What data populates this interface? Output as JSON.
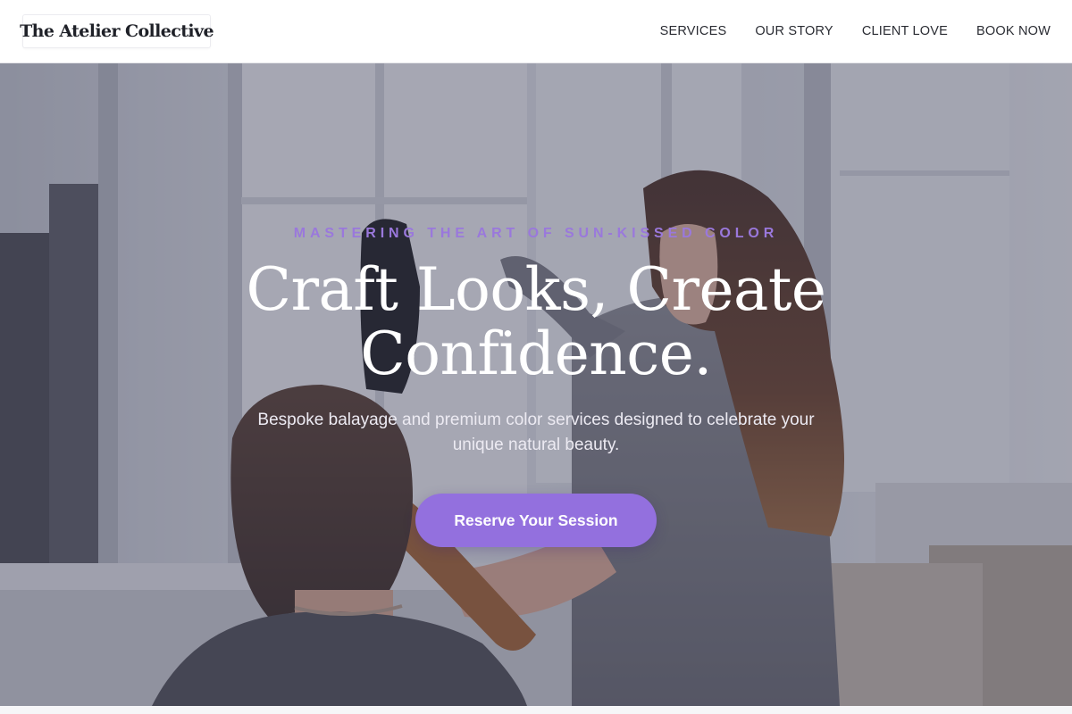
{
  "brand": {
    "name": "The Atelier Collective"
  },
  "nav": {
    "items": [
      {
        "label": "SERVICES"
      },
      {
        "label": "OUR STORY"
      },
      {
        "label": "CLIENT LOVE"
      },
      {
        "label": "BOOK NOW"
      }
    ]
  },
  "hero": {
    "eyebrow": "MASTERING THE ART OF SUN-KISSED COLOR",
    "headline": "Craft Looks, Create Confidence.",
    "subheadline": "Bespoke balayage and premium color services designed to celebrate your unique natural beauty.",
    "cta_label": "Reserve Your Session",
    "background_image": "salon-stylist-blow-drying-client-photo"
  },
  "colors": {
    "accent": "#9370de",
    "eyebrow": "#9a78dc",
    "text_dark": "#1f2128"
  }
}
